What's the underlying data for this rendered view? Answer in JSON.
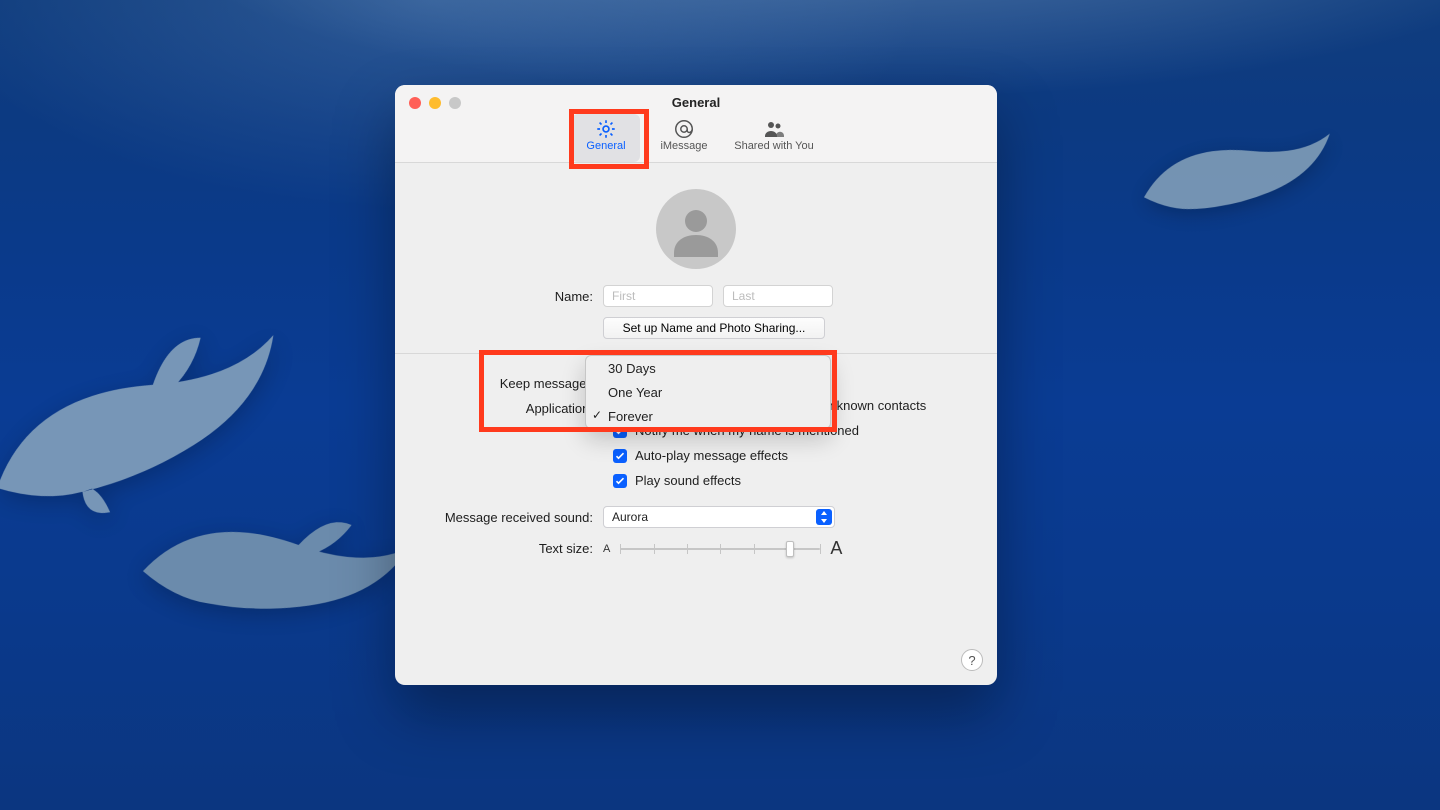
{
  "window": {
    "title": "General",
    "tabs": [
      {
        "label": "General",
        "icon": "gear-icon",
        "active": true
      },
      {
        "label": "iMessage",
        "icon": "at-icon",
        "active": false
      },
      {
        "label": "Shared with You",
        "icon": "people-icon",
        "active": false
      }
    ]
  },
  "form": {
    "name_label": "Name:",
    "first_placeholder": "First",
    "last_placeholder": "Last",
    "setup_button": "Set up Name and Photo Sharing...",
    "keep_label": "Keep messages",
    "application_label": "Application:",
    "checks": [
      "Notify me about messages from unknown contacts",
      "Notify me when my name is mentioned",
      "Auto-play message effects",
      "Play sound effects"
    ],
    "sound_label": "Message received sound:",
    "sound_value": "Aurora",
    "textsize_label": "Text size:",
    "textsize_small": "A",
    "textsize_big": "A"
  },
  "dropdown": {
    "options": [
      "30 Days",
      "One Year",
      "Forever"
    ],
    "selected": "Forever"
  },
  "help_glyph": "?"
}
